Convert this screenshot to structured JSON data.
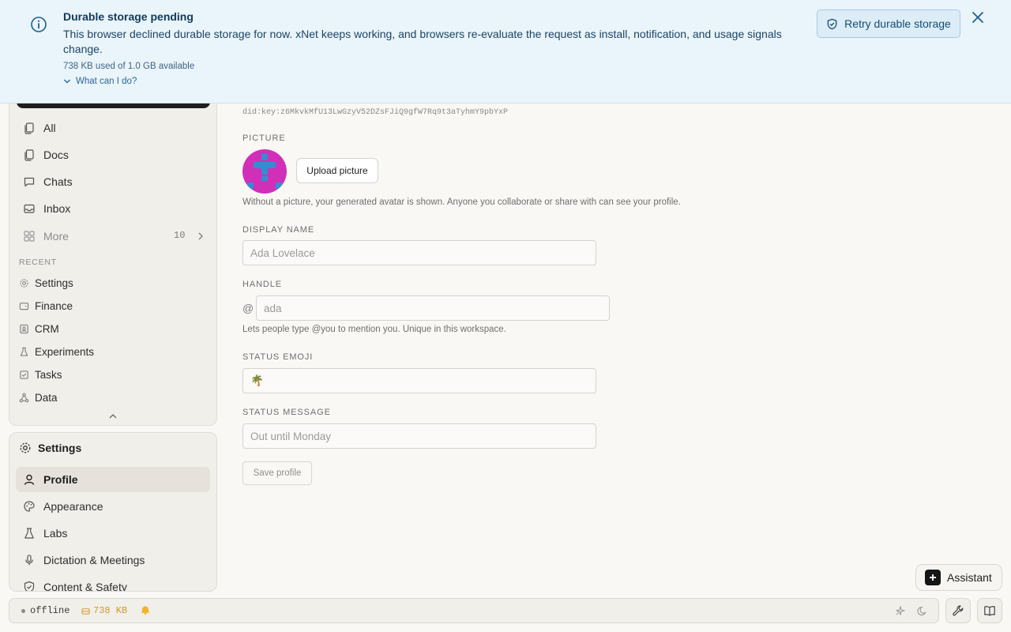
{
  "banner": {
    "title": "Durable storage pending",
    "body": "This browser declined durable storage for now. xNet keeps working, and browsers re-evaluate the request as install, notification, and usage signals change.",
    "usage": "738 KB used of 1.0 GB available",
    "what_can_i_do": "What can I do?",
    "retry_label": "Retry durable storage",
    "info_icon": "info-icon",
    "close_icon": "close-icon"
  },
  "sidebar": {
    "items": [
      {
        "label": "All",
        "icon": "files-icon"
      },
      {
        "label": "Docs",
        "icon": "doc-icon"
      },
      {
        "label": "Chats",
        "icon": "chat-icon"
      },
      {
        "label": "Inbox",
        "icon": "inbox-icon"
      }
    ],
    "more": {
      "label": "More",
      "count": "10"
    },
    "recent_label": "RECENT",
    "recent": [
      {
        "label": "Settings"
      },
      {
        "label": "Finance"
      },
      {
        "label": "CRM"
      },
      {
        "label": "Experiments"
      },
      {
        "label": "Tasks"
      },
      {
        "label": "Data"
      }
    ],
    "settings": {
      "title": "Settings",
      "items": [
        {
          "label": "Profile",
          "active": true
        },
        {
          "label": "Appearance"
        },
        {
          "label": "Labs"
        },
        {
          "label": "Dictation & Meetings"
        },
        {
          "label": "Content & Safety"
        }
      ]
    }
  },
  "profile": {
    "did": "did:key:z6MkvkMfU13LwGzyV52DZsFJiQ9gfW7Rq9t3aTyhmY9pbYxP",
    "picture_label": "PICTURE",
    "upload_label": "Upload picture",
    "picture_help": "Without a picture, your generated avatar is shown. Anyone you collaborate or share with can see your profile.",
    "display_name_label": "DISPLAY NAME",
    "display_name_placeholder": "Ada Lovelace",
    "handle_label": "HANDLE",
    "handle_prefix": "@",
    "handle_placeholder": "ada",
    "handle_help": "Lets people type @you to mention you. Unique in this workspace.",
    "status_emoji_label": "STATUS EMOJI",
    "status_emoji_value": "🌴",
    "status_message_label": "STATUS MESSAGE",
    "status_message_placeholder": "Out until Monday",
    "save_label": "Save profile",
    "avatar_colors": {
      "bg": "#d12fb8",
      "pattern": "#2f8fd1"
    }
  },
  "assistant": {
    "label": "Assistant"
  },
  "statusbar": {
    "connection": "offline",
    "storage": "738 KB"
  }
}
